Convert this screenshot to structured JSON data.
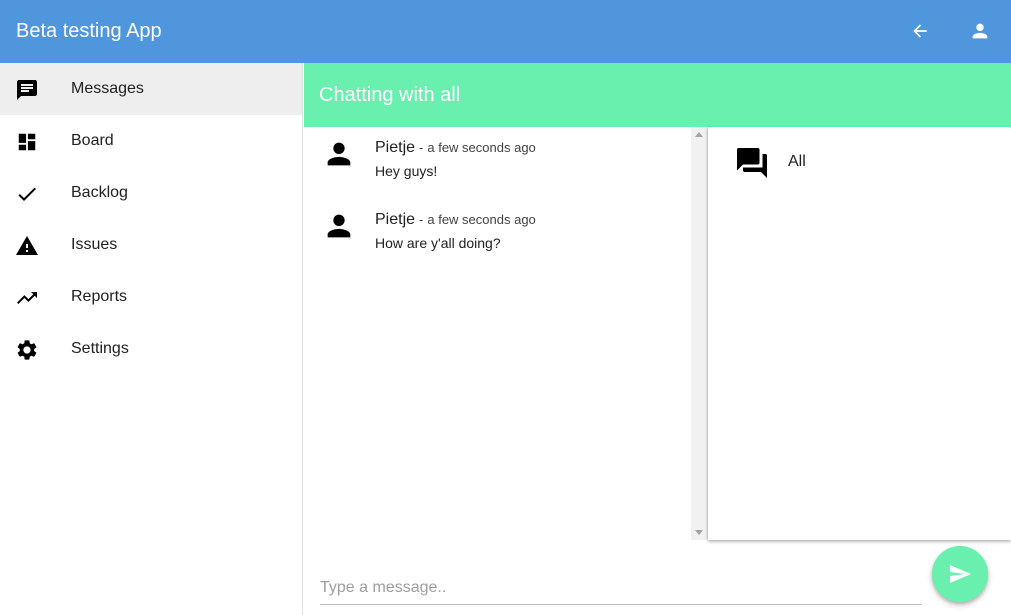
{
  "app": {
    "title": "Beta testing App"
  },
  "appbar": {
    "back_icon": "arrow-back-icon",
    "account_icon": "account-icon"
  },
  "sidebar": {
    "items": [
      {
        "label": "Messages",
        "icon": "message-icon",
        "active": true
      },
      {
        "label": "Board",
        "icon": "dashboard-icon",
        "active": false
      },
      {
        "label": "Backlog",
        "icon": "check-icon",
        "active": false
      },
      {
        "label": "Issues",
        "icon": "warning-icon",
        "active": false
      },
      {
        "label": "Reports",
        "icon": "trending-up-icon",
        "active": false
      },
      {
        "label": "Settings",
        "icon": "gear-icon",
        "active": false
      }
    ]
  },
  "chat": {
    "title": "Chatting with all",
    "separator": "-",
    "messages": [
      {
        "author": "Pietje",
        "time": "a few seconds ago",
        "text": "Hey guys!"
      },
      {
        "author": "Pietje",
        "time": "a few seconds ago",
        "text": "How are y'all doing?"
      }
    ],
    "channels": [
      {
        "label": "All",
        "icon": "forum-icon"
      }
    ]
  },
  "composer": {
    "placeholder": "Type a message..",
    "value": "",
    "send_icon": "send-icon"
  },
  "colors": {
    "appbar": "#5096dc",
    "accent": "#69f0ae",
    "active_item": "#eeeeee"
  }
}
